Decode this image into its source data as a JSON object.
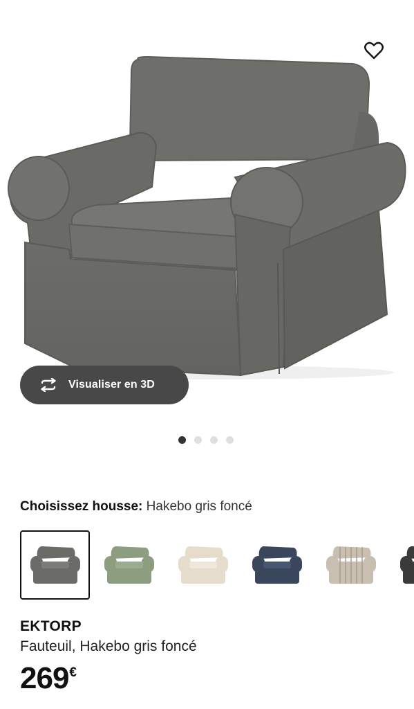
{
  "product": {
    "brand": "EKTORP",
    "description": "Fauteuil, Hakebo gris foncé",
    "price": "269",
    "currency": "€"
  },
  "gallery": {
    "view3d_label": "Visualiser en 3D",
    "dots": 4,
    "active_dot": 0
  },
  "cover": {
    "label": "Choisissez housse:",
    "value": "Hakebo gris foncé"
  },
  "swatches": [
    {
      "name": "Hakebo gris foncé",
      "color": "#6b6c68",
      "selected": true
    },
    {
      "name": "vert",
      "color": "#8c9d80",
      "selected": false
    },
    {
      "name": "beige",
      "color": "#e5dccb",
      "selected": false
    },
    {
      "name": "bleu foncé",
      "color": "#39465c",
      "selected": false
    },
    {
      "name": "rayé",
      "color": "#c9bfb1",
      "selected": false
    },
    {
      "name": "noir",
      "color": "#3a3a3a",
      "selected": false
    }
  ],
  "colors": {
    "chair": "#6e6f6b",
    "button_bg": "#484848",
    "text": "#111111"
  },
  "icons": {
    "favorite": "heart-icon",
    "rotate3d": "rotate-3d-icon"
  }
}
